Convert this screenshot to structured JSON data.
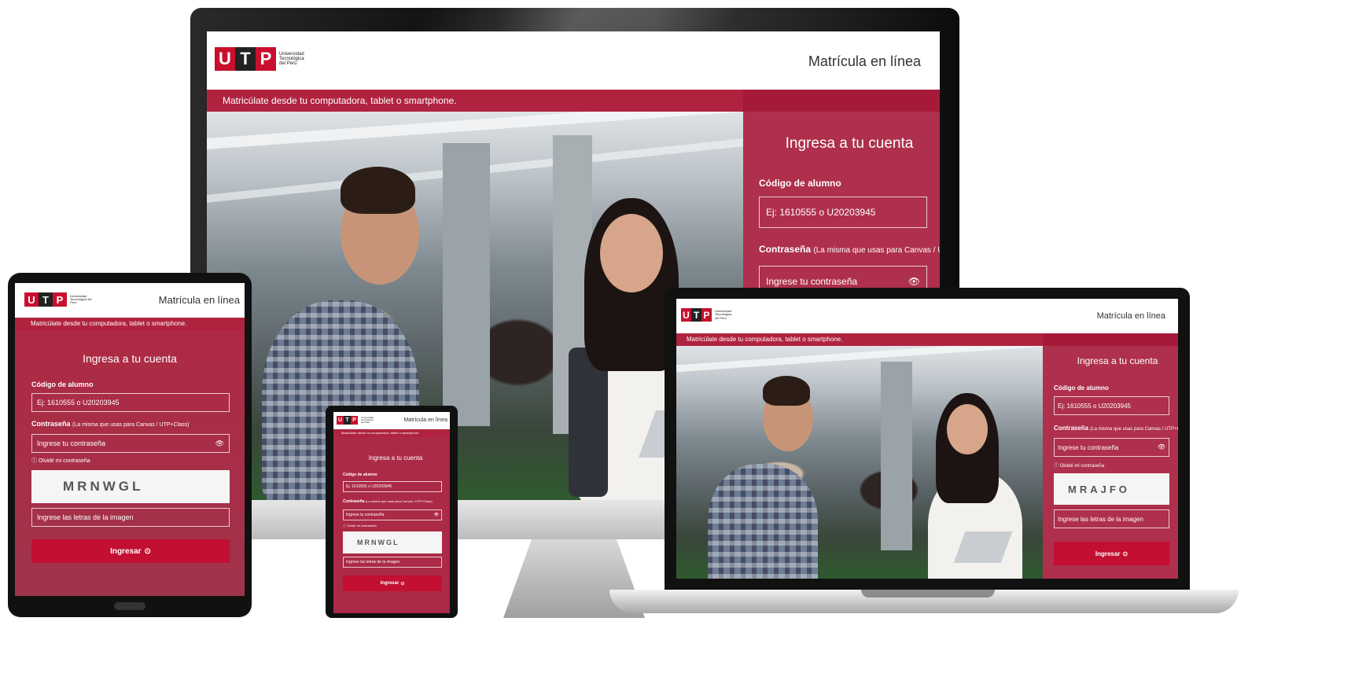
{
  "brand": {
    "logo_letters": [
      "U",
      "T",
      "P"
    ],
    "logo_text": "Universidad Tecnológica del Perú",
    "accent": "#c8102e",
    "panel": "#a01834"
  },
  "header": {
    "title": "Matrícula en línea"
  },
  "band": {
    "text": "Matricúlate desde tu computadora, tablet o smartphone."
  },
  "login": {
    "heading": "Ingresa a tu cuenta",
    "code_label": "Código de alumno",
    "code_placeholder": "Ej: 1610555 o U20203945",
    "password_label": "Contraseña",
    "password_hint": "(La misma que usas para Canvas / UTP+Class)",
    "password_placeholder": "Ingrese tu contraseña",
    "forgot": "Olvidé mi contraseña",
    "captcha_placeholder": "Ingrese las letras de la imagen",
    "submit": "Ingresar"
  },
  "captchas": {
    "tablet": "MRNWGL",
    "phone": "MRNWGL",
    "laptop": "MRAJFO"
  },
  "icons": {
    "eye": "eye-icon",
    "info": "info-icon",
    "arrow": "arrow-circle-icon"
  }
}
